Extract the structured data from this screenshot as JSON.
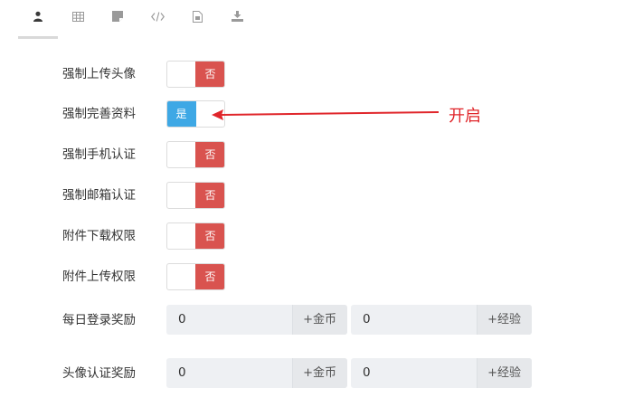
{
  "tabs": [
    {
      "icon": "user-icon",
      "active": true
    },
    {
      "icon": "table-icon",
      "active": false
    },
    {
      "icon": "note-icon",
      "active": false
    },
    {
      "icon": "code-icon",
      "active": false
    },
    {
      "icon": "file-icon",
      "active": false
    },
    {
      "icon": "download-icon",
      "active": false
    }
  ],
  "settings": {
    "force_avatar": {
      "label": "强制上传头像",
      "state": "否"
    },
    "force_profile": {
      "label": "强制完善资料",
      "state": "是"
    },
    "force_phone": {
      "label": "强制手机认证",
      "state": "否"
    },
    "force_email": {
      "label": "强制邮箱认证",
      "state": "否"
    },
    "attach_download": {
      "label": "附件下载权限",
      "state": "否"
    },
    "attach_upload": {
      "label": "附件上传权限",
      "state": "否"
    }
  },
  "rewards": {
    "daily_login": {
      "label": "每日登录奖励",
      "gold_value": "0",
      "gold_addon": "+金币",
      "exp_value": "0",
      "exp_addon": "+经验"
    },
    "avatar_verify": {
      "label": "头像认证奖励",
      "gold_value": "0",
      "gold_addon": "+金币",
      "exp_value": "0",
      "exp_addon": "+经验"
    }
  },
  "annotation": {
    "text": "开启"
  },
  "colors": {
    "off": "#d9534f",
    "on": "#3ea8e5",
    "annotation": "#e0262b"
  }
}
